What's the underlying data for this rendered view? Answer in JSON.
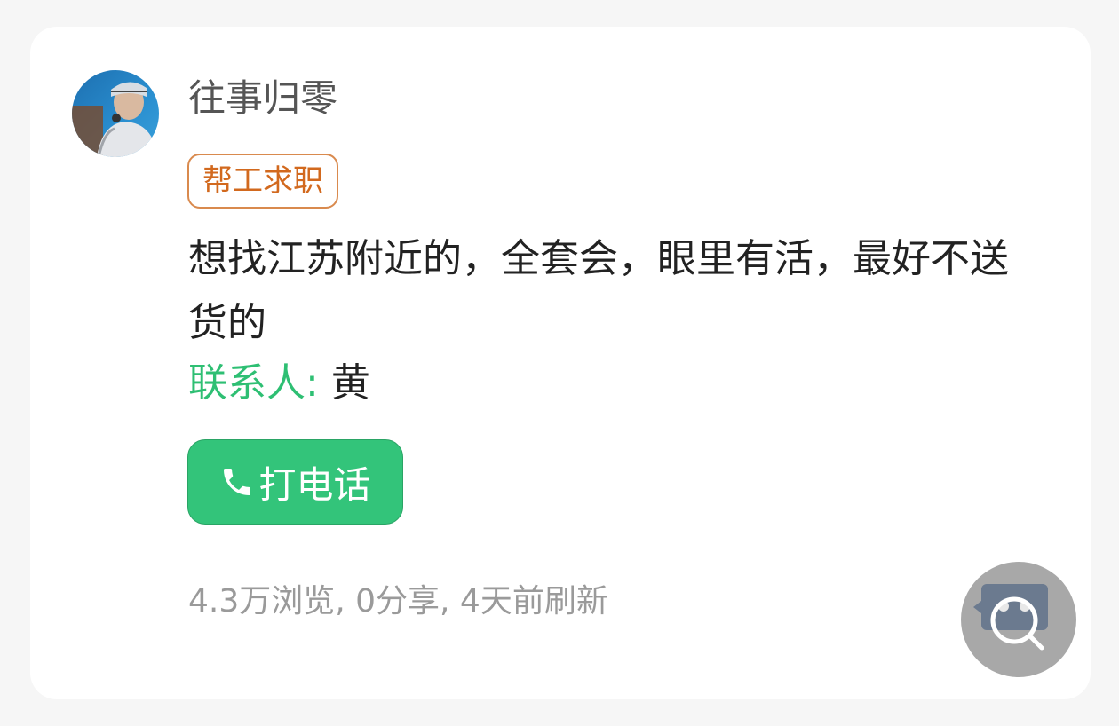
{
  "post": {
    "author_name": "往事归零",
    "category_tag": "帮工求职",
    "content": "想找江苏附近的，全套会，眼里有活，最好不送货的",
    "contact_label": "联系人:",
    "contact_name": "黄",
    "call_button_label": "打电话",
    "stats": "4.3万浏览, 0分享, 4天前刷新"
  },
  "icons": {
    "call": "phone-icon",
    "floating": "search-icon"
  },
  "colors": {
    "accent_green": "#33c47a",
    "tag_orange": "#d2691e",
    "stats_gray": "#9a9a9a",
    "floating_button": "#a8a8a8"
  }
}
